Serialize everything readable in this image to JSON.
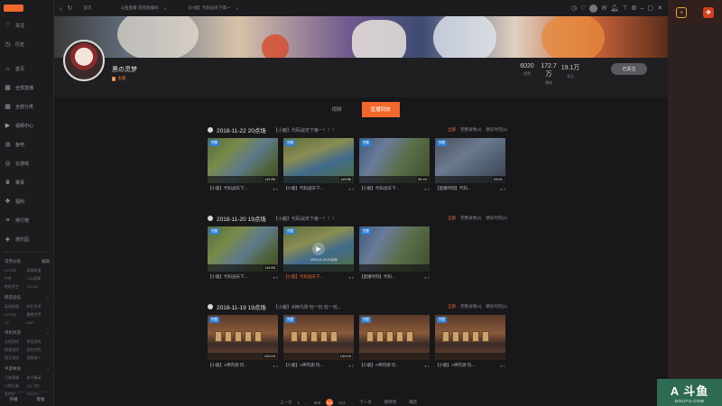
{
  "sidebar": {
    "items": [
      {
        "icon": "heart-icon",
        "label": "关注"
      },
      {
        "icon": "clock-icon",
        "label": "历史"
      },
      {
        "icon": "home-icon",
        "label": "首页"
      },
      {
        "icon": "grid-icon",
        "label": "全部直播"
      },
      {
        "icon": "grid-icon",
        "label": "全部分类"
      },
      {
        "icon": "video-icon",
        "label": "视频中心"
      },
      {
        "icon": "fish-icon",
        "label": "鱼吧"
      },
      {
        "icon": "game-icon",
        "label": "云游戏"
      },
      {
        "icon": "trophy-icon",
        "label": "赛事"
      },
      {
        "icon": "gift-icon",
        "label": "福利"
      },
      {
        "icon": "rank-icon",
        "label": "排行榜"
      },
      {
        "icon": "app-icon",
        "label": "游乐园"
      }
    ],
    "groups": [
      {
        "title": "常用分类",
        "action": "编辑",
        "items": [
          "DOTA2",
          "英雄联盟",
          "户外",
          "LOL赛事",
          "绝地求生",
          "CS:GO"
        ]
      },
      {
        "title": "网游竞技",
        "items": [
          "英雄联盟",
          "炉石传说",
          "DOTA2",
          "魔兽世界",
          "CF",
          "DNF"
        ]
      },
      {
        "title": "单机热游",
        "items": [
          "主机游戏",
          "怀旧游戏",
          "刺激战场",
          "我的世界",
          "独立游戏",
          "怪物猎人"
        ]
      },
      {
        "title": "手游休闲",
        "items": [
          "王者荣耀",
          "和平精英",
          "火影忍者",
          "QQ飞车",
          "金铲铲",
          "CS:GO"
        ]
      }
    ],
    "bottom": {
      "start": "开播",
      "mobile": "客服"
    }
  },
  "topbar": {
    "tabs": [
      {
        "label": "斗鱼"
      },
      {
        "label": "首页"
      },
      {
        "label": "斗鱼直播·游戏直播间"
      },
      {
        "label": "【小鹿】代码战天下第一"
      }
    ],
    "nav": {
      "back": "‹",
      "refresh": "↻"
    }
  },
  "banner": {
    "name": "黑の灵梦",
    "level": "6",
    "badge": "主播",
    "stats": [
      {
        "value": "6020",
        "label": "视频"
      },
      {
        "value": "172.7万",
        "label": "播放"
      },
      {
        "value": "19.1万",
        "label": "关注"
      }
    ],
    "follow": "已关注"
  },
  "content_tabs": {
    "video": "视频",
    "replay": "直播回放"
  },
  "sections": [
    {
      "date": "2018-11-22 20点场",
      "subtitle": "【小鹿】代码战天下第一！！！",
      "filters": [
        "全部",
        "完整录像(4)",
        "精彩时刻(1)"
      ],
      "videos": [
        {
          "title": "【小鹿】代码战天下...",
          "views": "6",
          "duration": "119:56",
          "badge": "完整"
        },
        {
          "title": "【小鹿】代码战天下...",
          "views": "4",
          "duration": "119:56",
          "badge": "完整"
        },
        {
          "title": "【小鹿】代码战天下...",
          "views": "3",
          "duration": "30:44",
          "badge": "完整"
        },
        {
          "title": "【直播时刻】代码...",
          "views": "2",
          "duration": "03:01",
          "badge": "完整"
        }
      ]
    },
    {
      "date": "2018-11-20 19点场",
      "subtitle": "【小鹿】代码战天下第一！！！",
      "filters": [
        "全部",
        "完整录像(2)",
        "精彩时刻(1)"
      ],
      "videos": [
        {
          "title": "【小鹿】代码战天下...",
          "views": "8",
          "duration": "119:53",
          "badge": "完整"
        },
        {
          "title": "【小鹿】代码战天下...",
          "views": "6",
          "duration": "",
          "badge": "完整",
          "stamp": "2018-11-20 19点场"
        },
        {
          "title": "【直播时刻】代码...",
          "views": "2",
          "duration": "",
          "badge": "完整"
        }
      ]
    },
    {
      "date": "2018-11-19 19点场",
      "subtitle": "【小鹿】A神内测 玩一玩 玩一玩...",
      "filters": [
        "全部",
        "完整录像(4)",
        "精彩时刻(1)"
      ],
      "videos": [
        {
          "title": "【小鹿】A神内测 玩...",
          "views": "4",
          "duration": "120:03",
          "badge": "完整"
        },
        {
          "title": "【小鹿】A神内测 玩...",
          "views": "2",
          "duration": "120:04",
          "badge": "完整"
        },
        {
          "title": "【小鹿】A神内测 玩...",
          "views": "1",
          "duration": "",
          "badge": "完整"
        },
        {
          "title": "【小鹿】A神内测 玩...",
          "views": "1",
          "duration": "",
          "badge": "完整"
        }
      ]
    }
  ],
  "pager": {
    "prev": "上一页",
    "pages": [
      "1",
      "...",
      "309",
      "310",
      "311",
      "..."
    ],
    "current": "310",
    "next": "下一页",
    "jump": "跳转到",
    "go": "确定"
  },
  "watermark": {
    "big": "A 斗鱼",
    "small": "DOUYU.COM"
  },
  "colors": {
    "accent": "#f4672a",
    "badge": "#2f7fd4",
    "watermark": "#2d6b52"
  }
}
